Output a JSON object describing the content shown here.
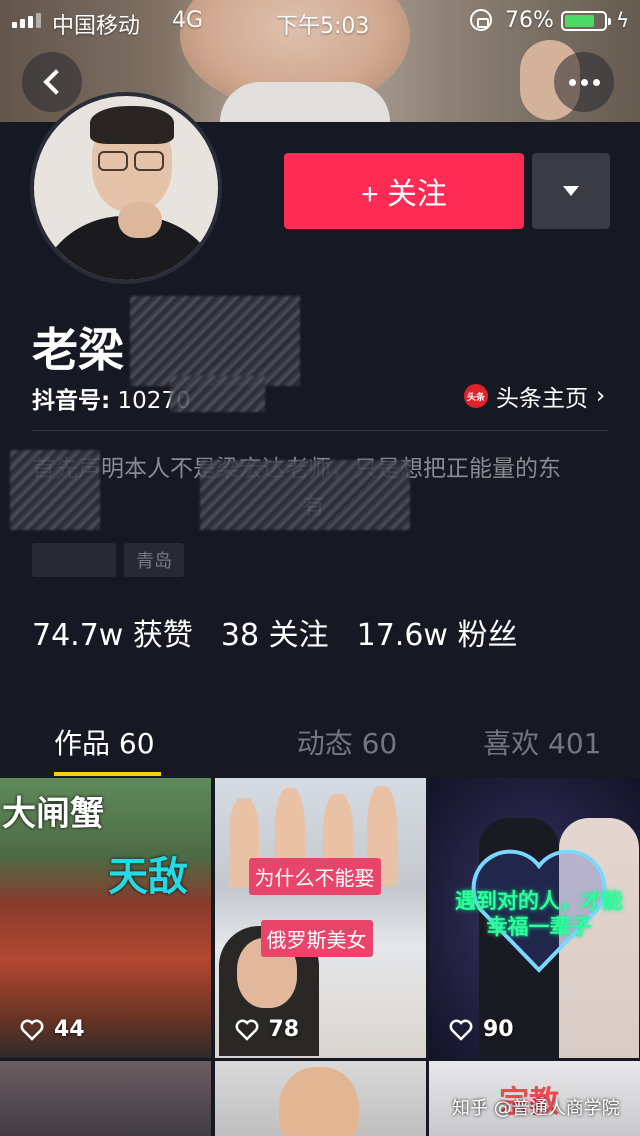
{
  "status_bar": {
    "carrier": "中国移动",
    "network": "4G",
    "time": "下午5:03",
    "battery_percent": "76%",
    "battery_level": 0.76
  },
  "profile": {
    "name": "老梁",
    "id_label": "抖音号:",
    "id_value": "10270",
    "toutiao_logo": "头条",
    "toutiao_link": "头条主页",
    "bio": "首先声明本人不是梁宏达老师，只是想把正能量的东",
    "bio_line2": "有",
    "tags": [
      "",
      "青岛"
    ]
  },
  "actions": {
    "follow_label": "+ 关注",
    "dropdown_icon": "caret-down-icon"
  },
  "stats": {
    "likes": "74.7w",
    "likes_label": "获赞",
    "following": "38",
    "following_label": "关注",
    "followers": "17.6w",
    "followers_label": "粉丝"
  },
  "tabs": [
    {
      "label": "作品 60",
      "active": true
    },
    {
      "label": "动态 60",
      "active": false
    },
    {
      "label": "喜欢 401",
      "active": false
    }
  ],
  "videos": [
    {
      "likes": "44",
      "title1": "大闸蟹",
      "title2": "天敌"
    },
    {
      "likes": "78",
      "title1": "为什么不能娶",
      "title2": "俄罗斯美女"
    },
    {
      "likes": "90",
      "title1": "遇到对的人，才能",
      "title2": "幸福一辈子"
    }
  ],
  "video_row2": {
    "partial_text": "宗教"
  },
  "watermark": "知乎 @普通人商学院",
  "colors": {
    "follow_button": "#fe2c55",
    "tab_underline": "#face15",
    "background": "#161823"
  }
}
